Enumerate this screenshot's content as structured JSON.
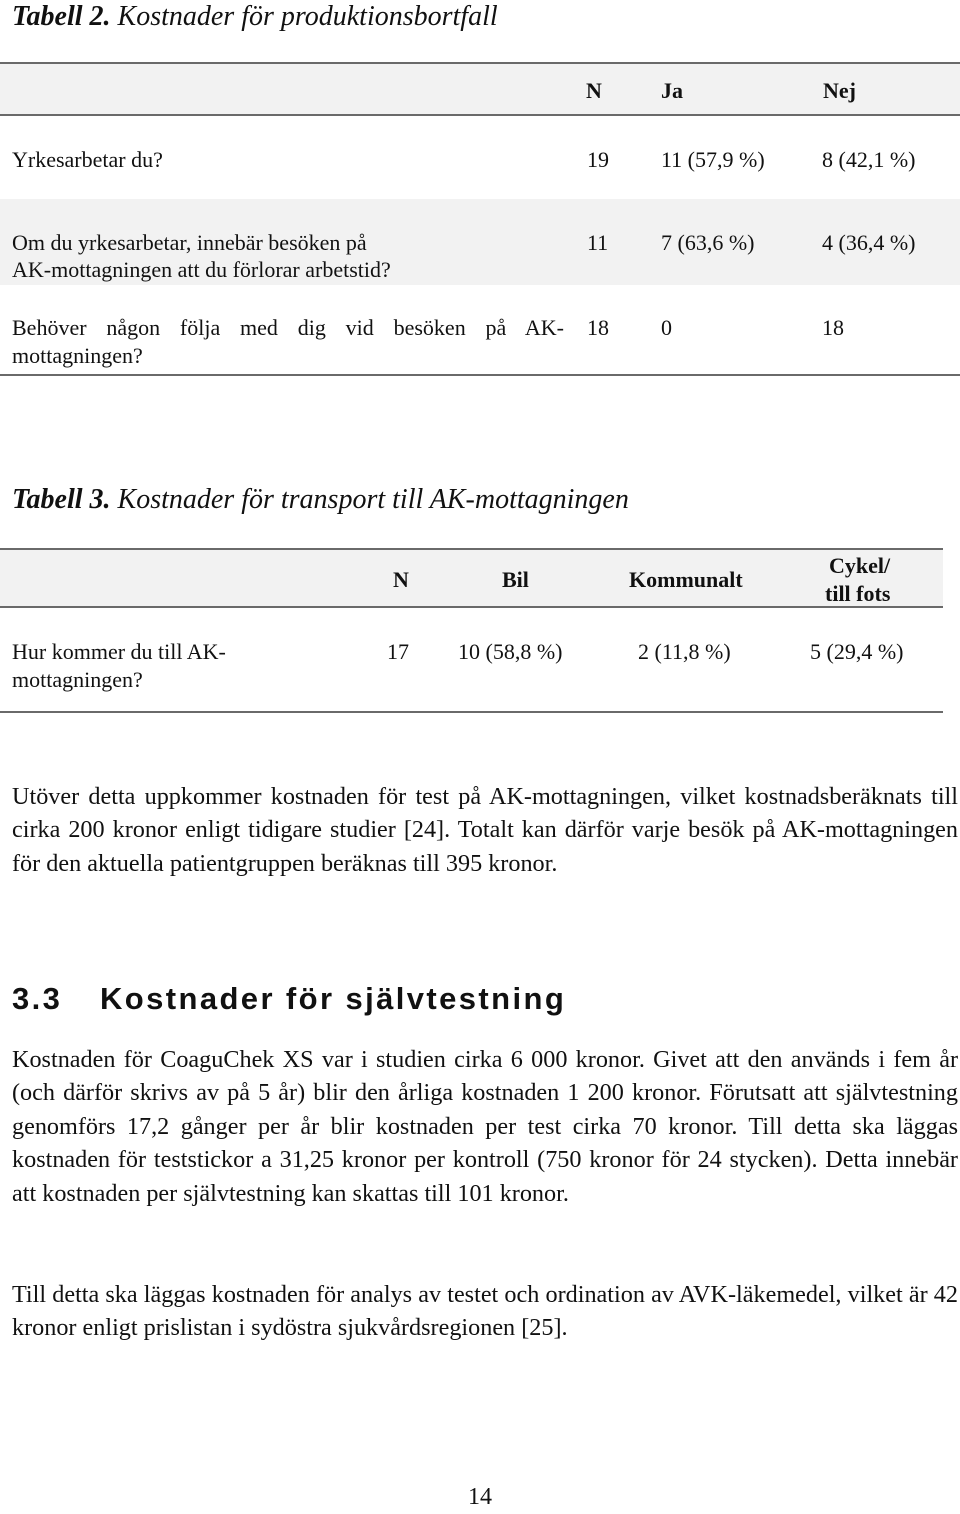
{
  "table2": {
    "caption_label": "Tabell 2.",
    "caption_title": "Kostnader för produktionsbortfall",
    "headers": [
      "",
      "N",
      "Ja",
      "Nej"
    ],
    "rows": [
      {
        "question": "Yrkesarbetar du?",
        "n": "19",
        "ja": "11 (57,9 %)",
        "nej": "8 (42,1 %)"
      },
      {
        "question_line1": "Om du yrkesarbetar, innebär besöken på",
        "question_line2": "AK-mottagningen att du förlorar arbetstid?",
        "n": "11",
        "ja": "7 (63,6 %)",
        "nej": "4 (36,4 %)"
      },
      {
        "question_line1": "Behöver någon följa med dig vid besöken på AK-",
        "question_line2": "mottagningen?",
        "n": "18",
        "ja": "0",
        "nej": "18"
      }
    ]
  },
  "table3": {
    "caption_label": "Tabell 3.",
    "caption_title": "Kostnader för transport till AK-mottagningen",
    "headers": [
      "",
      "N",
      "Bil",
      "Kommunalt",
      "Cykel/",
      "till fots"
    ],
    "rows": [
      {
        "question_line1": "Hur kommer du till AK-",
        "question_line2": "mottagningen?",
        "n": "17",
        "bil": "10 (58,8 %)",
        "kommunalt": "2 (11,8 %)",
        "cykel": "5 (29,4 %)"
      }
    ]
  },
  "paragraph1": "Utöver detta uppkommer kostnaden för test på AK-mottagningen, vilket kostnadsberäknats till cirka 200 kronor enligt tidigare studier [24]. Totalt kan därför varje besök på AK-mottagningen för den aktuella patientgruppen beräknas till 395 kronor.",
  "section": {
    "number": "3.3",
    "title": "Kostnader för självtestning"
  },
  "paragraph2": "Kostnaden för CoaguChek XS var i studien cirka 6 000 kronor. Givet att den används i fem år (och därför skrivs av på 5 år) blir den årliga kostnaden 1 200 kronor. Förutsatt att självtestning genomförs 17,2 gånger per år blir kostnaden per test cirka 70 kronor. Till detta ska läggas kostnaden för teststickor a 31,25 kronor per kontroll (750 kronor för 24 stycken). Detta innebär att kostnaden per självtestning kan skattas till 101 kronor.",
  "paragraph3": "Till detta ska läggas kostnaden för analys av testet och ordination av AVK-läkemedel, vilket är 42 kronor enligt prislistan i sydöstra sjukvårdsregionen [25].",
  "page_number": "14"
}
